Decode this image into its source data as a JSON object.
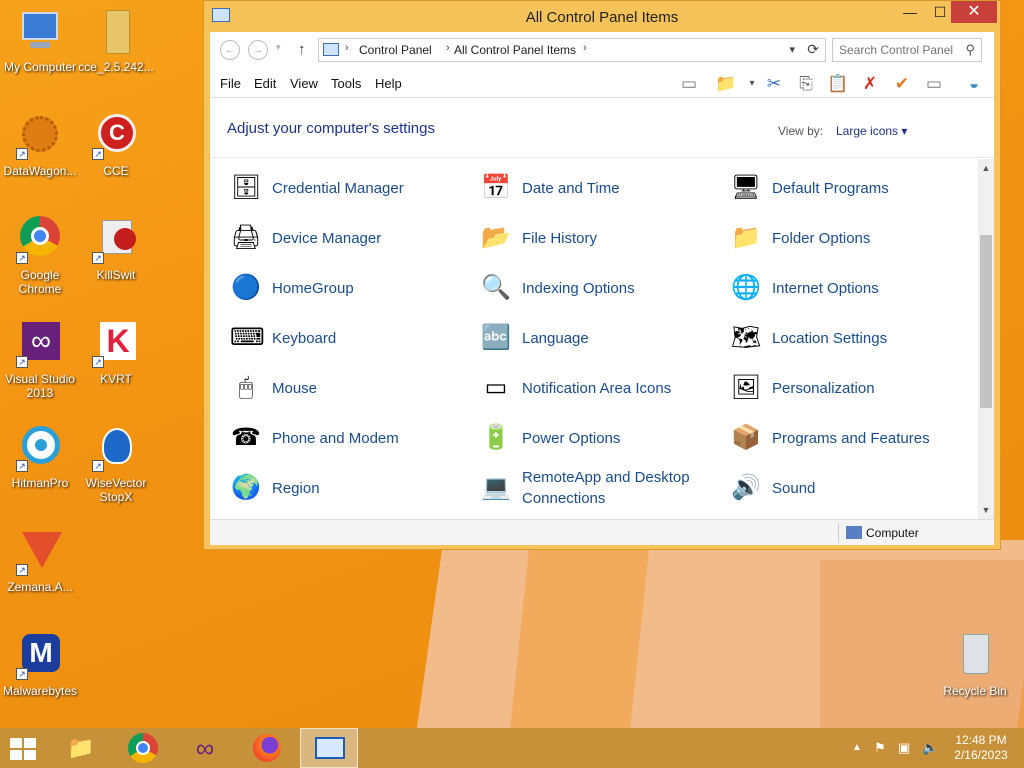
{
  "desktop": {
    "icons": [
      {
        "label": "My Computer"
      },
      {
        "label": "cce_2.5.242..."
      },
      {
        "label": "DataWagon..."
      },
      {
        "label": "CCE"
      },
      {
        "label": "Google Chrome"
      },
      {
        "label": "KillSwit"
      },
      {
        "label": "Visual Studio 2013"
      },
      {
        "label": "KVRT"
      },
      {
        "label": "HitmanPro"
      },
      {
        "label": "WiseVector StopX"
      },
      {
        "label": "Zemana.A..."
      },
      {
        "label": "Malwarebytes"
      },
      {
        "label": "Recycle Bin"
      }
    ]
  },
  "window": {
    "title": "All Control Panel Items",
    "close_glyph": "✕",
    "address": {
      "crumbs": [
        "Control Panel",
        "All Control Panel Items"
      ],
      "sep": "›"
    },
    "search_placeholder": "Search Control Panel",
    "menu": [
      "File",
      "Edit",
      "View",
      "Tools",
      "Help"
    ],
    "heading": "Adjust your computer's settings",
    "view_by_label": "View by:",
    "view_by_value": "Large icons ▾",
    "items": [
      {
        "label": "Credential Manager",
        "icon": "🗄"
      },
      {
        "label": "Date and Time",
        "icon": "📅"
      },
      {
        "label": "Default Programs",
        "icon": "🖥"
      },
      {
        "label": "Device Manager",
        "icon": "🖨"
      },
      {
        "label": "File History",
        "icon": "📂"
      },
      {
        "label": "Folder Options",
        "icon": "📁"
      },
      {
        "label": "HomeGroup",
        "icon": "🔵"
      },
      {
        "label": "Indexing Options",
        "icon": "🔍"
      },
      {
        "label": "Internet Options",
        "icon": "🌐"
      },
      {
        "label": "Keyboard",
        "icon": "⌨"
      },
      {
        "label": "Language",
        "icon": "🔤"
      },
      {
        "label": "Location Settings",
        "icon": "🗺"
      },
      {
        "label": "Mouse",
        "icon": "🖱"
      },
      {
        "label": "Notification Area Icons",
        "icon": "▭"
      },
      {
        "label": "Personalization",
        "icon": "🖼"
      },
      {
        "label": "Phone and Modem",
        "icon": "☎"
      },
      {
        "label": "Power Options",
        "icon": "🔋"
      },
      {
        "label": "Programs and Features",
        "icon": "📦"
      },
      {
        "label": "Region",
        "icon": "🌍"
      },
      {
        "label": "RemoteApp and Desktop Connections",
        "icon": "💻"
      },
      {
        "label": "Sound",
        "icon": "🔊"
      }
    ],
    "status_text": "Computer"
  },
  "taskbar": {
    "clock_time": "12:48 PM",
    "clock_date": "2/16/2023"
  }
}
